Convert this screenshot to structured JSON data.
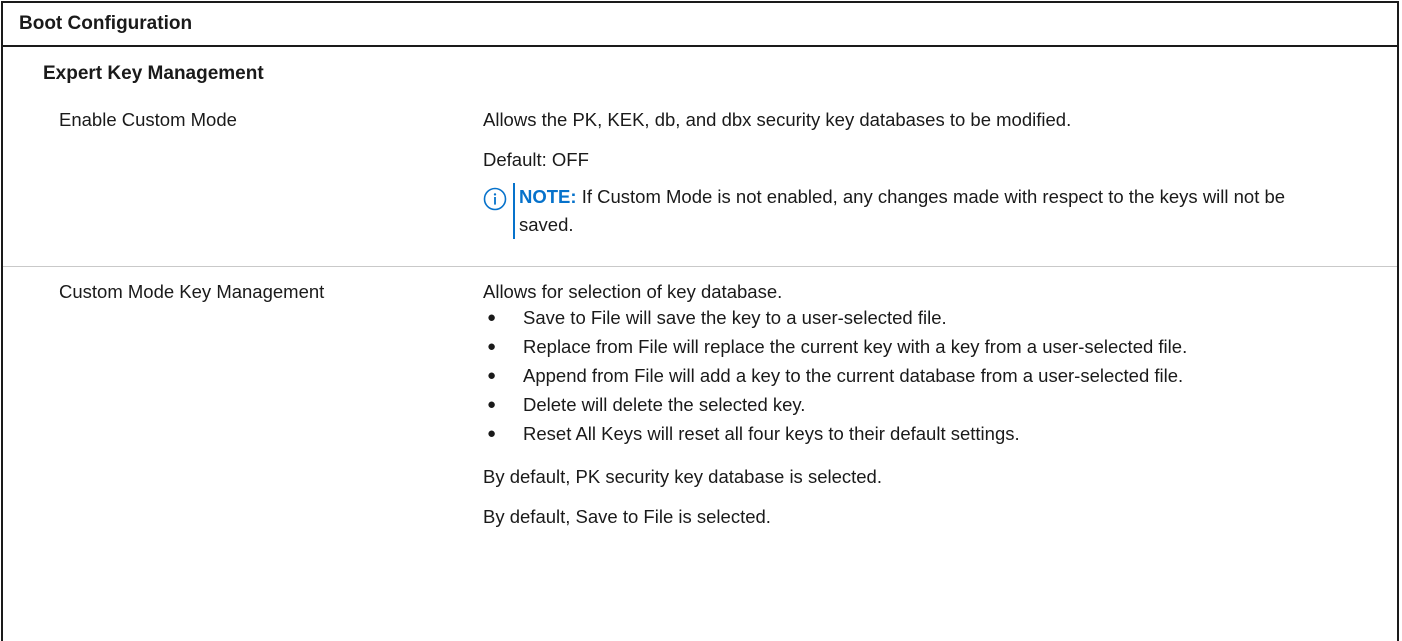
{
  "table_title": "Boot Configuration",
  "section_title": "Expert Key Management",
  "rows": [
    {
      "label": "Enable Custom Mode",
      "description": "Allows the PK, KEK, db, and dbx security key databases to be modified.",
      "default": "Default: OFF",
      "note": {
        "icon": "info-icon",
        "prefix": "NOTE:",
        "text": "If Custom Mode is not enabled, any changes made with respect to the keys will not be saved."
      }
    },
    {
      "label": "Custom Mode Key Management",
      "description": "Allows for selection of key database.",
      "bullets": [
        "Save to File will save the key to a user-selected file.",
        "Replace from File will replace the current key with a key from a user-selected file.",
        "Append from File will add a key to the current database from a user-selected file.",
        "Delete will delete the selected key.",
        "Reset All Keys will reset all four keys to their default settings."
      ],
      "footnotes": [
        "By default, PK security key database is selected.",
        "By default, Save to File is selected."
      ]
    }
  ],
  "colors": {
    "note_accent": "#0672cb",
    "text": "#1a1a1a",
    "border": "#1a1a1a"
  }
}
